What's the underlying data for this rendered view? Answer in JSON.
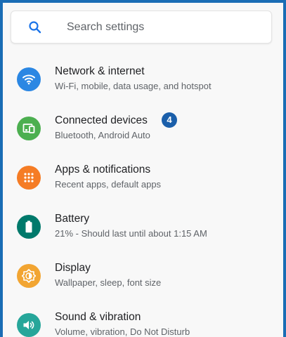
{
  "search": {
    "icon": "search-icon",
    "placeholder": "Search settings"
  },
  "items": [
    {
      "title": "Network & internet",
      "subtitle": "Wi-Fi, mobile, data usage, and hotspot",
      "icon": "wifi-icon",
      "color": "#2b87e3"
    },
    {
      "title": "Connected devices",
      "subtitle": "Bluetooth, Android Auto",
      "icon": "connected-devices-icon",
      "color": "#4caf50",
      "badge": "4"
    },
    {
      "title": "Apps & notifications",
      "subtitle": "Recent apps, default apps",
      "icon": "apps-grid-icon",
      "color": "#f57c25"
    },
    {
      "title": "Battery",
      "subtitle": "21% - Should last until about 1:15 AM",
      "icon": "battery-icon",
      "color": "#00796b"
    },
    {
      "title": "Display",
      "subtitle": "Wallpaper, sleep, font size",
      "icon": "brightness-icon",
      "color": "#f2a532"
    },
    {
      "title": "Sound & vibration",
      "subtitle": "Volume, vibration, Do Not Disturb",
      "icon": "volume-icon",
      "color": "#26a69a"
    }
  ],
  "badge_color": "#1b5faa",
  "frame_color": "#1a6db5"
}
